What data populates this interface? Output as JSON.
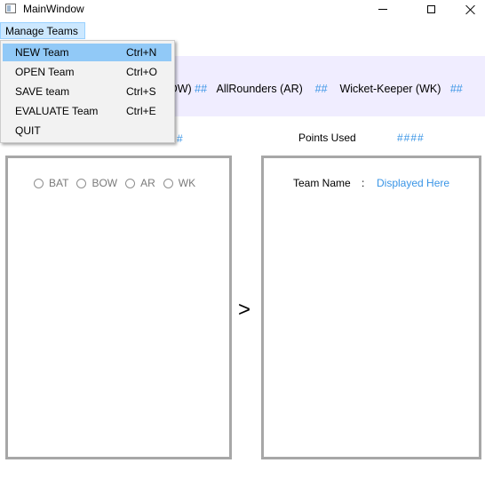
{
  "window": {
    "title": "MainWindow",
    "controls": {
      "minimize": "minimize-icon",
      "maximize": "maximize-icon",
      "close": "close-icon"
    }
  },
  "menubar": {
    "items": [
      {
        "label": "Manage Teams"
      }
    ]
  },
  "dropdown": {
    "items": [
      {
        "label": "NEW Team",
        "shortcut": "Ctrl+N"
      },
      {
        "label": "OPEN Team",
        "shortcut": "Ctrl+O"
      },
      {
        "label": "SAVE team",
        "shortcut": "Ctrl+S"
      },
      {
        "label": "EVALUATE Team",
        "shortcut": "Ctrl+E"
      },
      {
        "label": "QUIT",
        "shortcut": ""
      }
    ]
  },
  "stats": {
    "bowlers_suffix": "OW)",
    "hash": "##",
    "allrounders_label": "AllRounders (AR)",
    "wicketkeeper_label": "Wicket-Keeper (WK)",
    "hash_partial": "#",
    "points_used_label": "Points Used",
    "points_used_value": "####"
  },
  "left_panel": {
    "radios": [
      {
        "label": "BAT"
      },
      {
        "label": "BOW"
      },
      {
        "label": "AR"
      },
      {
        "label": "WK"
      }
    ]
  },
  "transfer_button": {
    "label": ">"
  },
  "right_panel": {
    "team_name_label": "Team Name",
    "colon": ":",
    "team_name_value": "Displayed Here"
  },
  "colors": {
    "accent_hash": "#3a95e6",
    "banner_bg": "#f0edff",
    "menu_highlight": "#91c9f7",
    "menubar_highlight": "#cce8ff",
    "panel_border": "#a7a7a7"
  }
}
